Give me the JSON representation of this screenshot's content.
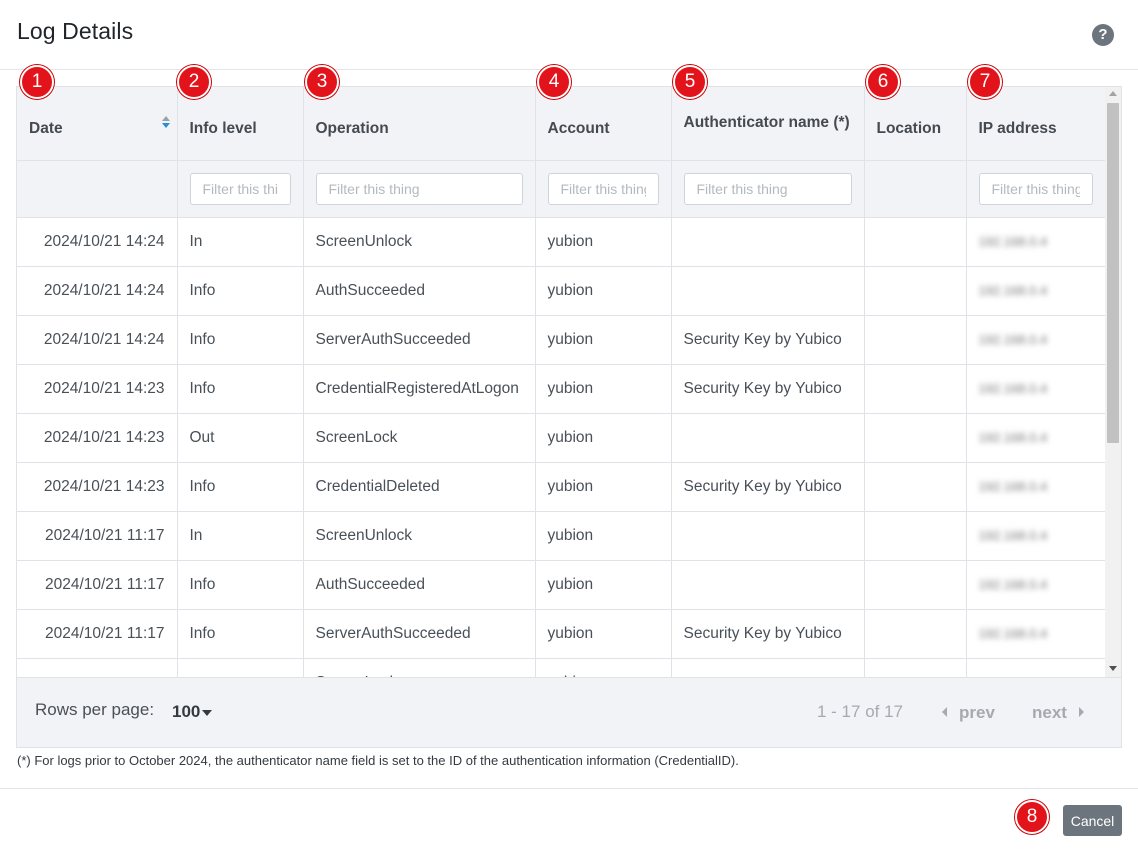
{
  "dialog": {
    "title": "Log Details",
    "help_icon": "question-circle-icon",
    "help_symbol": "?"
  },
  "columns": [
    {
      "key": "date",
      "label": "Date",
      "filter_placeholder": null
    },
    {
      "key": "info_level",
      "label": "Info level",
      "filter_placeholder": "Filter this thing"
    },
    {
      "key": "operation",
      "label": "Operation",
      "filter_placeholder": "Filter this thing"
    },
    {
      "key": "account",
      "label": "Account",
      "filter_placeholder": "Filter this thing"
    },
    {
      "key": "authenticator",
      "label": "Authenticator name (*)",
      "filter_placeholder": "Filter this thing"
    },
    {
      "key": "location",
      "label": "Location",
      "filter_placeholder": null
    },
    {
      "key": "ip",
      "label": "IP address",
      "filter_placeholder": "Filter this thing"
    }
  ],
  "rows": [
    {
      "date": "2024/10/21 14:24",
      "info_level": "In",
      "operation": "ScreenUnlock",
      "account": "yubion",
      "authenticator": "",
      "location": "",
      "ip": "192.168.0.4"
    },
    {
      "date": "2024/10/21 14:24",
      "info_level": "Info",
      "operation": "AuthSucceeded",
      "account": "yubion",
      "authenticator": "",
      "location": "",
      "ip": "192.168.0.4"
    },
    {
      "date": "2024/10/21 14:24",
      "info_level": "Info",
      "operation": "ServerAuthSucceeded",
      "account": "yubion",
      "authenticator": "Security Key by Yubico",
      "location": "",
      "ip": "192.168.0.4"
    },
    {
      "date": "2024/10/21 14:23",
      "info_level": "Info",
      "operation": "CredentialRegisteredAtLogon",
      "account": "yubion",
      "authenticator": "Security Key by Yubico",
      "location": "",
      "ip": "192.168.0.4"
    },
    {
      "date": "2024/10/21 14:23",
      "info_level": "Out",
      "operation": "ScreenLock",
      "account": "yubion",
      "authenticator": "",
      "location": "",
      "ip": "192.168.0.4"
    },
    {
      "date": "2024/10/21 14:23",
      "info_level": "Info",
      "operation": "CredentialDeleted",
      "account": "yubion",
      "authenticator": "Security Key by Yubico",
      "location": "",
      "ip": "192.168.0.4"
    },
    {
      "date": "2024/10/21 11:17",
      "info_level": "In",
      "operation": "ScreenUnlock",
      "account": "yubion",
      "authenticator": "",
      "location": "",
      "ip": "192.168.0.4"
    },
    {
      "date": "2024/10/21 11:17",
      "info_level": "Info",
      "operation": "AuthSucceeded",
      "account": "yubion",
      "authenticator": "",
      "location": "",
      "ip": "192.168.0.4"
    },
    {
      "date": "2024/10/21 11:17",
      "info_level": "Info",
      "operation": "ServerAuthSucceeded",
      "account": "yubion",
      "authenticator": "Security Key by Yubico",
      "location": "",
      "ip": "192.168.0.4"
    },
    {
      "date": "",
      "info_level": "",
      "operation": "ScreenLock",
      "account": "yubion",
      "authenticator": "",
      "location": "",
      "ip": ""
    }
  ],
  "pagination": {
    "rows_per_page_label": "Rows per page:",
    "rows_per_page_value": "100",
    "range_text": "1 - 17 of 17",
    "prev_label": "prev",
    "next_label": "next"
  },
  "footnote": "(*) For logs prior to October 2024, the authenticator name field is set to the ID of the authentication information (CredentialID).",
  "cancel_label": "Cancel",
  "markers": [
    "1",
    "2",
    "3",
    "4",
    "5",
    "6",
    "7",
    "8"
  ],
  "colors": {
    "marker": "#e3131b",
    "header_bg": "#f2f3f6",
    "cancel_bg": "#6c757d",
    "sort_active": "#2a8bd6"
  }
}
